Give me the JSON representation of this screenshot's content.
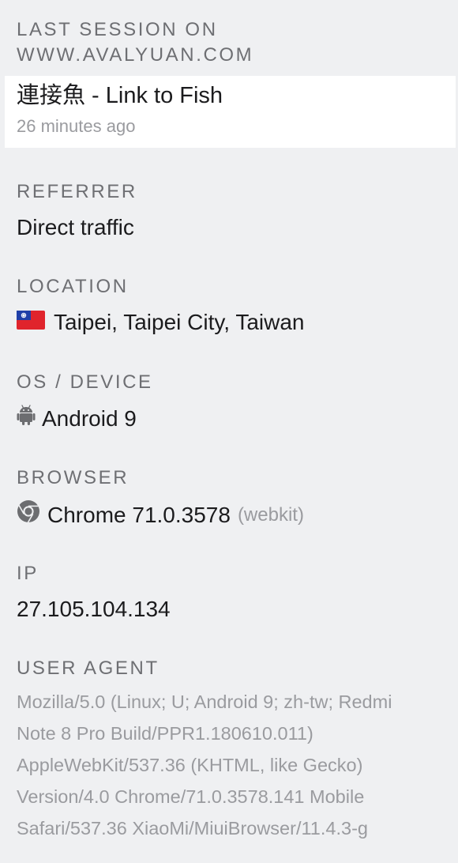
{
  "last_session": {
    "label_line1": "LAST SESSION ON",
    "label_line2": "WWW.AVALYUAN.COM",
    "page_title": "連接魚 - Link to Fish",
    "time_ago": "26 minutes ago"
  },
  "referrer": {
    "label": "REFERRER",
    "value": "Direct traffic"
  },
  "location": {
    "label": "LOCATION",
    "value": "Taipei, Taipei City, Taiwan",
    "flag_icon": "taiwan-flag-icon"
  },
  "os_device": {
    "label": "OS / DEVICE",
    "value": "Android 9",
    "icon": "android-icon"
  },
  "browser": {
    "label": "BROWSER",
    "value": "Chrome 71.0.3578",
    "engine": "(webkit)",
    "icon": "chrome-icon"
  },
  "ip": {
    "label": "IP",
    "value": "27.105.104.134"
  },
  "user_agent": {
    "label": "USER AGENT",
    "lines": [
      "Mozilla/5.0 (Linux; U; Android 9; zh-tw; Redmi",
      "Note 8 Pro Build/PPR1.180610.011)",
      "AppleWebKit/537.36 (KHTML, like Gecko)",
      "Version/4.0 Chrome/71.0.3578.141 Mobile",
      "Safari/537.36 XiaoMi/MiuiBrowser/11.4.3-g"
    ]
  },
  "colors": {
    "background": "#eff0f2",
    "card": "#ffffff",
    "label": "#6e6f73",
    "muted": "#9a9b9f",
    "text": "#1b1b1d"
  }
}
